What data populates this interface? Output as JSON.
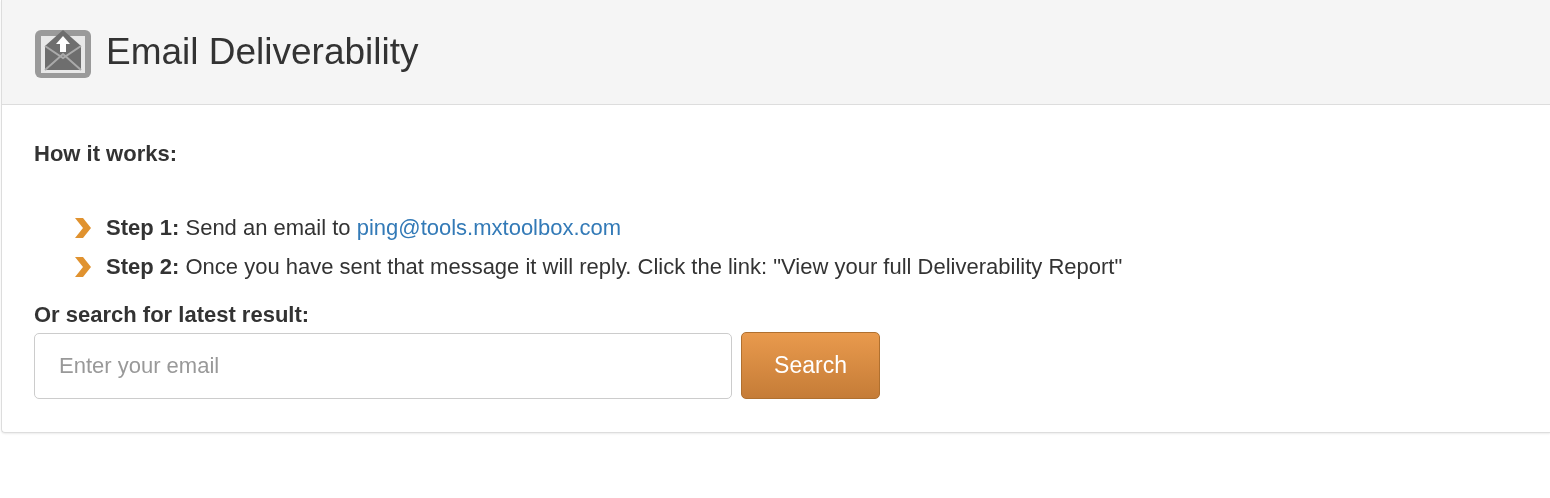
{
  "panel": {
    "title": "Email Deliverability"
  },
  "intro": "How it works:",
  "steps": [
    {
      "text": "**Step 1:** Send an email to ",
      "link": "ping@tools.mxtoolbox.com"
    },
    {
      "text": "**Step 2:** Once you have sent that message it will reply. Click the link: \"View your full Deliverability Report\""
    }
  ],
  "search": {
    "label": "Or search for latest result:",
    "placeholder": "Enter your email",
    "button": "Search"
  }
}
